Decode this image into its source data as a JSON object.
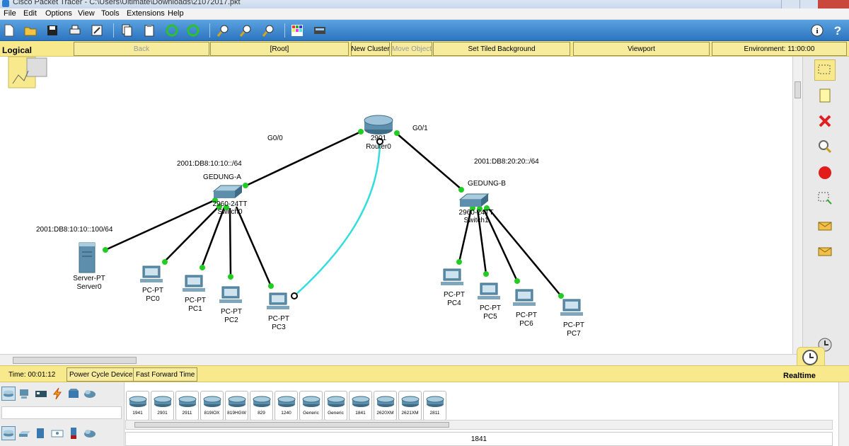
{
  "window": {
    "title": "Cisco Packet Tracer - C:\\Users\\Ultimate\\Downloads\\21072017.pkt"
  },
  "menu": [
    "File",
    "Edit",
    "Options",
    "View",
    "Tools",
    "Extensions",
    "Help"
  ],
  "logical_bar": {
    "label": "Logical",
    "back": "Back",
    "root": "[Root]",
    "new_cluster": "New Cluster",
    "move_object": "Move Object",
    "set_tiled_background": "Set Tiled Background",
    "viewport": "Viewport",
    "environment": "Environment: 11:00:00"
  },
  "topology": {
    "router": {
      "model": "2901",
      "name": "Router0"
    },
    "ports": {
      "g00": "G0/0",
      "g01": "G0/1"
    },
    "switch_a": {
      "model": "2960-24TT",
      "name": "Switch0",
      "label": "GEDUNG-A",
      "network": "2001:DB8:10:10::/64"
    },
    "switch_b": {
      "model": "2960-24TT",
      "name": "Switch1",
      "label": "GEDUNG-B",
      "network": "2001:DB8:20:20::/64"
    },
    "server": {
      "type": "Server-PT",
      "name": "Server0",
      "address": "2001:DB8:10:10::100/64"
    },
    "pcs": [
      {
        "type": "PC-PT",
        "name": "PC0"
      },
      {
        "type": "PC-PT",
        "name": "PC1"
      },
      {
        "type": "PC-PT",
        "name": "PC2"
      },
      {
        "type": "PC-PT",
        "name": "PC3"
      },
      {
        "type": "PC-PT",
        "name": "PC4"
      },
      {
        "type": "PC-PT",
        "name": "PC5"
      },
      {
        "type": "PC-PT",
        "name": "PC6"
      },
      {
        "type": "PC-PT",
        "name": "PC7"
      }
    ]
  },
  "time_bar": {
    "time": "Time: 00:01:12",
    "power_cycle": "Power Cycle Devices",
    "fast_forward": "Fast Forward Time",
    "mode": "Realtime"
  },
  "device_list": [
    "1941",
    "2901",
    "2911",
    "819IOX",
    "819HGW",
    "829",
    "1240",
    "Generic",
    "Generic",
    "1841",
    "2620XM",
    "2621XM",
    "2811"
  ],
  "selected_device": "1841",
  "colors": {
    "toolbar": "#3d87d0",
    "yellow_bar": "#f8e98d",
    "link_up": "#22cc22",
    "console_cable": "#33dddd"
  }
}
